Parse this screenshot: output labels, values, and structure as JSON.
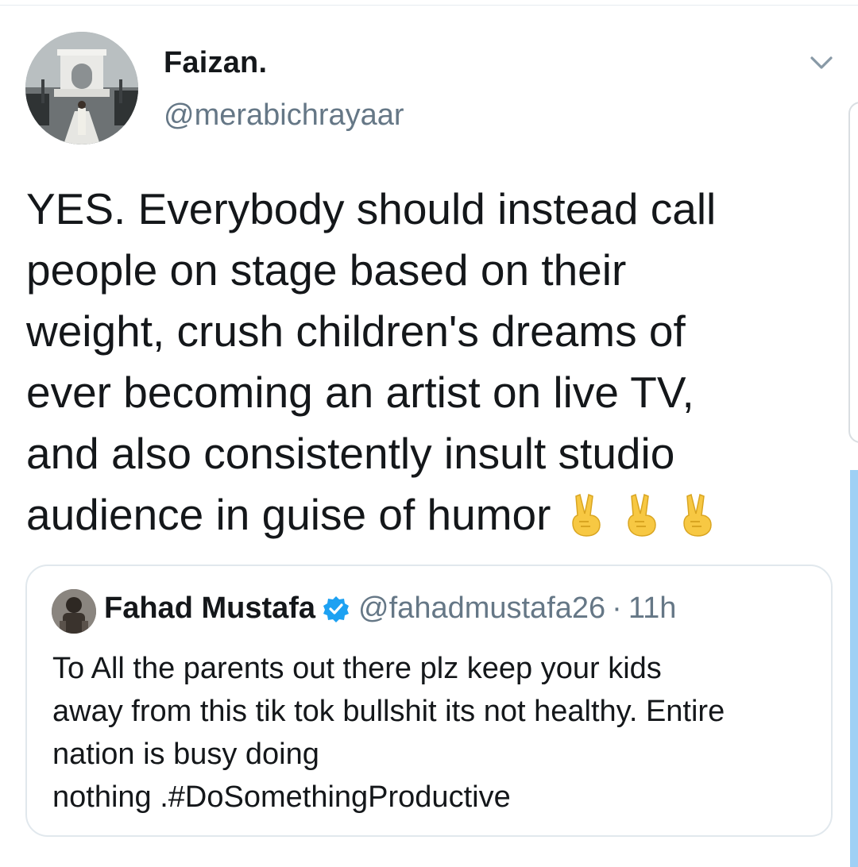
{
  "tweet": {
    "author": {
      "display_name": "Faizan.",
      "handle": "@merabichrayaar"
    },
    "text_lines": [
      "YES. Everybody should instead call",
      "people on stage based on their",
      "weight, crush children's dreams of",
      "ever becoming an artist on live TV,",
      "and also consistently insult studio",
      "audience in guise of humor"
    ],
    "emojis": [
      "victory-hand-emoji",
      "victory-hand-emoji",
      "victory-hand-emoji"
    ],
    "menu_icon": "chevron-down-icon"
  },
  "quoted_tweet": {
    "author": {
      "display_name": "Fahad Mustafa",
      "handle": "@fahadmustafa26",
      "verified": true
    },
    "separator": "·",
    "timestamp": "11h",
    "text_lines": [
      "To All the parents out there plz keep your kids",
      "away from this tik tok bullshit its not healthy. Entire",
      "nation is busy doing",
      "nothing .#DoSomethingProductive"
    ]
  },
  "colors": {
    "text_primary": "#14171a",
    "text_secondary": "#657786",
    "border": "#e1e8ed",
    "verified_blue": "#1da1f2",
    "emoji_yellow": "#f7c843"
  }
}
